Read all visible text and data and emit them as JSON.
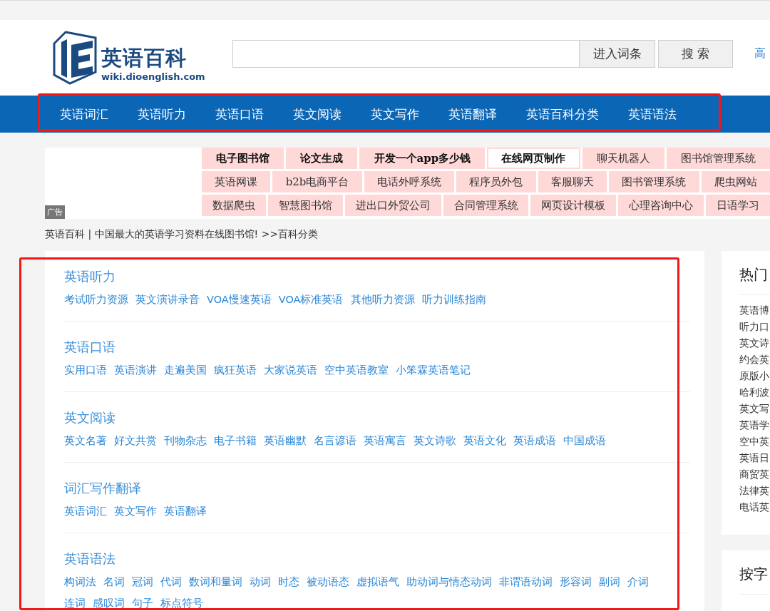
{
  "header": {
    "logo_title": "英语百科",
    "logo_domain": "wiki.dioenglish.com",
    "search": {
      "buttons": [
        "进入词条",
        "搜 索"
      ]
    },
    "side_link": "高"
  },
  "nav": {
    "items": [
      "英语词汇",
      "英语听力",
      "英语口语",
      "英文阅读",
      "英文写作",
      "英语翻译",
      "英语百科分类",
      "英语语法"
    ]
  },
  "ad": {
    "label": "广告",
    "rows": [
      [
        {
          "text": "电子图书馆",
          "bold": true,
          "highlighted": false
        },
        {
          "text": "论文生成",
          "bold": true,
          "highlighted": false
        },
        {
          "text": "开发一个app多少钱",
          "bold": true,
          "highlighted": false
        },
        {
          "text": "在线网页制作",
          "bold": true,
          "highlighted": true
        },
        {
          "text": "聊天机器人",
          "bold": false,
          "highlighted": false
        },
        {
          "text": "图书馆管理系统",
          "bold": false,
          "highlighted": false
        }
      ],
      [
        {
          "text": "英语网课",
          "bold": false,
          "highlighted": false
        },
        {
          "text": "b2b电商平台",
          "bold": false,
          "highlighted": false
        },
        {
          "text": "电话外呼系统",
          "bold": false,
          "highlighted": false
        },
        {
          "text": "程序员外包",
          "bold": false,
          "highlighted": false
        },
        {
          "text": "客服聊天",
          "bold": false,
          "highlighted": false
        },
        {
          "text": "图书管理系统",
          "bold": false,
          "highlighted": false
        },
        {
          "text": "爬虫网站",
          "bold": false,
          "highlighted": false
        }
      ],
      [
        {
          "text": "数据爬虫",
          "bold": false,
          "highlighted": false
        },
        {
          "text": "智慧图书馆",
          "bold": false,
          "highlighted": false
        },
        {
          "text": "进出口外贸公司",
          "bold": false,
          "highlighted": false
        },
        {
          "text": "合同管理系统",
          "bold": false,
          "highlighted": false
        },
        {
          "text": "网页设计模板",
          "bold": false,
          "highlighted": false
        },
        {
          "text": "心理咨询中心",
          "bold": false,
          "highlighted": false
        },
        {
          "text": "日语学习",
          "bold": false,
          "highlighted": false
        }
      ]
    ]
  },
  "breadcrumb": "英语百科 | 中国最大的英语学习资料在线图书馆! >>百科分类",
  "categories": [
    {
      "title": "英语听力",
      "links": [
        "考试听力资源",
        "英文演讲录音",
        "VOA慢速英语",
        "VOA标准英语",
        "其他听力资源",
        "听力训练指南"
      ]
    },
    {
      "title": "英语口语",
      "links": [
        "实用口语",
        "英语演讲",
        "走遍美国",
        "疯狂英语",
        "大家说英语",
        "空中英语教室",
        "小笨霖英语笔记"
      ]
    },
    {
      "title": "英文阅读",
      "links": [
        "英文名著",
        "好文共赏",
        "刊物杂志",
        "电子书籍",
        "英语幽默",
        "名言谚语",
        "英语寓言",
        "英文诗歌",
        "英语文化",
        "英语成语",
        "中国成语"
      ]
    },
    {
      "title": "词汇写作翻译",
      "links": [
        "英语词汇",
        "英文写作",
        "英语翻译"
      ]
    },
    {
      "title": "英语语法",
      "links": [
        "构词法",
        "名词",
        "冠词",
        "代词",
        "数词和量词",
        "动词",
        "时态",
        "被动语态",
        "虚拟语气",
        "助动词与情态动词",
        "非谓语动词",
        "形容词",
        "副词",
        "介词",
        "连词",
        "感叹词",
        "句子",
        "标点符号"
      ]
    }
  ],
  "sidebar": [
    {
      "title": "热门",
      "items": [
        "英语博",
        "听力口",
        "英文诗",
        "约会英",
        "原版小",
        "哈利波",
        "英文写",
        "英语学",
        "空中英",
        "英语日",
        "商贸英",
        "法律英",
        "电话英"
      ]
    },
    {
      "title": "按字"
    }
  ],
  "annotations": {
    "nav_frame": true,
    "content_frame": true
  }
}
